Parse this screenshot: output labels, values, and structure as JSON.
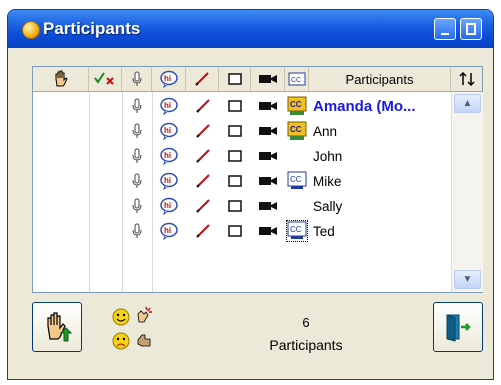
{
  "window": {
    "title": "Participants",
    "title_icon": "participants-bubble-icon"
  },
  "list": {
    "header_icons": [
      "raise-hand-icon",
      "yes-no-icon",
      "microphone-icon",
      "chat-icon",
      "pen-icon",
      "whiteboard-icon",
      "camera-icon",
      "closed-caption-icon"
    ],
    "header_label": "Participants",
    "sort_icon": "sort-icon",
    "participants": [
      {
        "name": "Amanda (Mo...",
        "moderator": true,
        "cc": "color"
      },
      {
        "name": "Ann",
        "moderator": false,
        "cc": "color"
      },
      {
        "name": "John",
        "moderator": false,
        "cc": "none"
      },
      {
        "name": "Mike",
        "moderator": false,
        "cc": "blue"
      },
      {
        "name": "Sally",
        "moderator": false,
        "cc": "none"
      },
      {
        "name": "Ted",
        "moderator": false,
        "cc": "blue-dotted"
      }
    ]
  },
  "footer": {
    "count": "6",
    "count_label": "Participants",
    "status_icons": [
      "happy-emoticon-icon",
      "applause-icon",
      "sad-emoticon-icon",
      "thumbs-icon"
    ],
    "raise_hand_button_icon": "raise-hand-icon",
    "exit_button_icon": "exit-door-icon"
  },
  "colors": {
    "title_bar": "#0b4bd6",
    "moderator_name": "#1a1ae6",
    "window_bg": "#ece9d8"
  }
}
